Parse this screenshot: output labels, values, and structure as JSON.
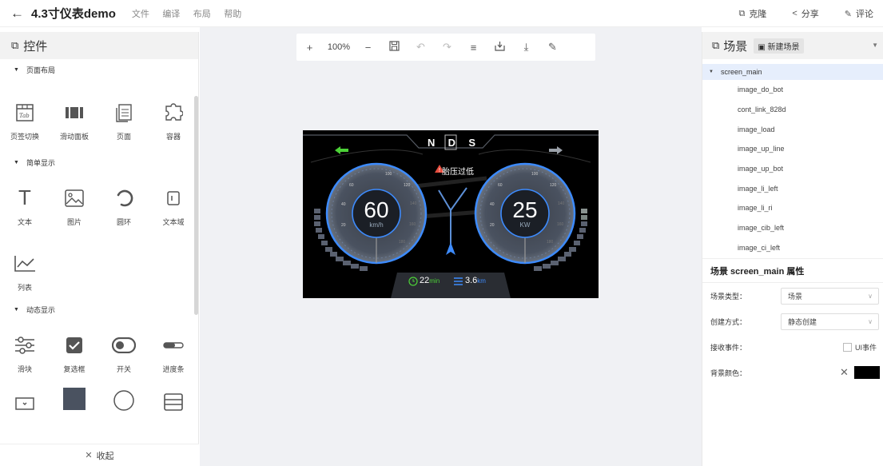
{
  "header": {
    "back_icon": "arrow-left-icon",
    "title": "4.3寸仪表demo",
    "menu": [
      "文件",
      "编译",
      "布局",
      "帮助"
    ],
    "actions": [
      {
        "icon": "clone-icon",
        "glyph": "⧉",
        "label": "克隆"
      },
      {
        "icon": "share-icon",
        "glyph": "≺",
        "label": "分享"
      },
      {
        "icon": "comment-icon",
        "glyph": "✎",
        "label": "评论"
      }
    ]
  },
  "left_panel": {
    "title": "控件",
    "sections": [
      {
        "title": "页面布局",
        "items": [
          {
            "label": "页签切换",
            "icon": "tab-icon"
          },
          {
            "label": "滑动面板",
            "icon": "slide-panel-icon"
          },
          {
            "label": "页面",
            "icon": "page-icon"
          },
          {
            "label": "容器",
            "icon": "container-icon"
          }
        ]
      },
      {
        "title": "简单显示",
        "items": [
          {
            "label": "文本",
            "icon": "text-icon"
          },
          {
            "label": "图片",
            "icon": "image-icon"
          },
          {
            "label": "圆环",
            "icon": "ring-icon"
          },
          {
            "label": "文本域",
            "icon": "textarea-icon"
          },
          {
            "label": "列表",
            "icon": "list-chart-icon"
          }
        ]
      },
      {
        "title": "动态显示",
        "items": [
          {
            "label": "滑块",
            "icon": "slider-icon"
          },
          {
            "label": "复选框",
            "icon": "checkbox-icon"
          },
          {
            "label": "开关",
            "icon": "switch-icon"
          },
          {
            "label": "进度条",
            "icon": "progress-icon"
          }
        ]
      }
    ],
    "collapse_label": "收起"
  },
  "toolbar": {
    "zoom": "100%",
    "tools": [
      "plus-icon",
      "minus-icon",
      "save-icon",
      "undo-icon",
      "redo-icon",
      "align-icon",
      "export-icon",
      "download-icon",
      "edit-icon"
    ]
  },
  "dashboard": {
    "gear": [
      "N",
      "D",
      "S"
    ],
    "warning": "胎压过低",
    "speed_value": "60",
    "speed_unit": "km/h",
    "power_value": "25",
    "power_unit": "KW",
    "left_ticks": [
      "20",
      "40",
      "60",
      "100",
      "120",
      "140",
      "160",
      "180"
    ],
    "right_ticks": [
      "20",
      "40",
      "60",
      "100",
      "120",
      "140",
      "160",
      "180"
    ],
    "time_value": "22",
    "time_unit": "min",
    "distance_value": "3.6",
    "distance_unit": "km",
    "left_arrow_color": "#4cd137",
    "accent_color": "#3d8bfd"
  },
  "right_panel": {
    "title": "场景",
    "new_scene": "新建场景",
    "tree_root": "screen_main",
    "tree_nodes": [
      "image_do_bot",
      "cont_link_828d",
      "image_load",
      "image_up_line",
      "image_up_bot",
      "image_li_left",
      "image_li_ri",
      "image_cib_left",
      "image_ci_left"
    ],
    "props_title": "场景 screen_main 属性",
    "props": {
      "scene_type_label": "场景类型：",
      "scene_type_value": "场景",
      "create_label": "创建方式：",
      "create_value": "静态创建",
      "event_label": "接收事件：",
      "event_option": "UI事件",
      "bg_label": "背景颜色：",
      "bg_color": "#000000"
    }
  }
}
